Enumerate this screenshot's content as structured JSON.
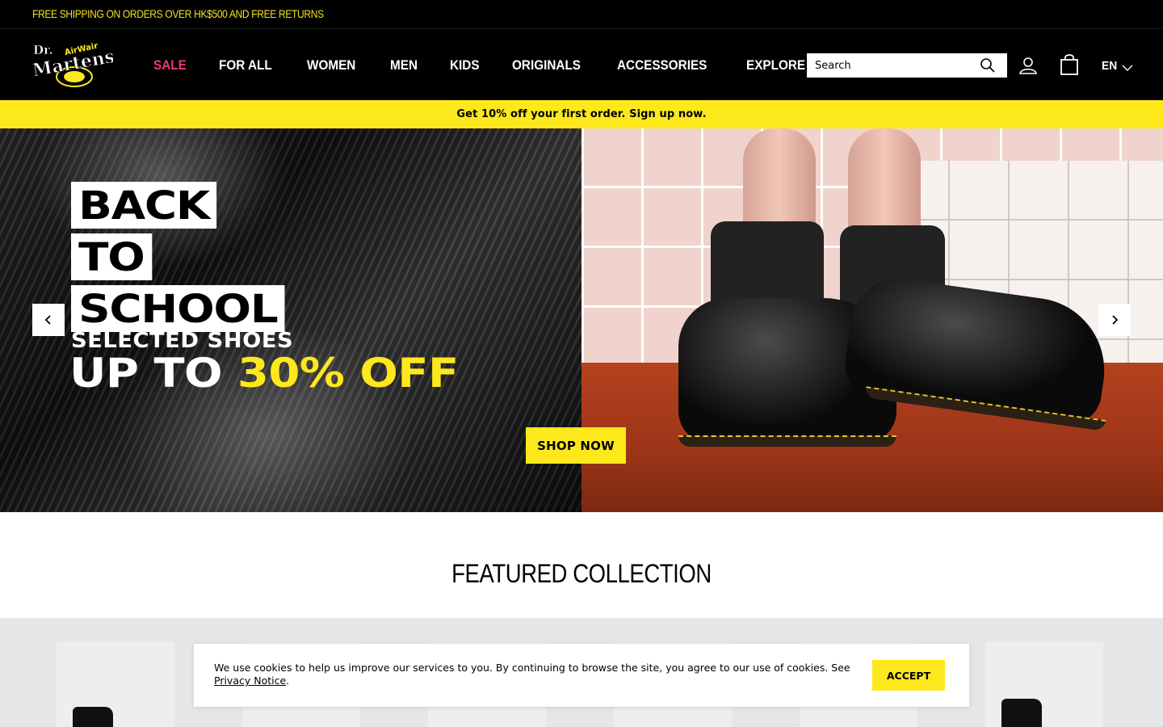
{
  "announcement": {
    "text": "FREE SHIPPING ON ORDERS OVER HK$500 AND FREE RETURNS"
  },
  "logo": {
    "text": "Dr. Martens AirWair"
  },
  "nav": {
    "items": [
      {
        "label": "SALE"
      },
      {
        "label": "FOR ALL"
      },
      {
        "label": "WOMEN"
      },
      {
        "label": "MEN"
      },
      {
        "label": "KIDS"
      },
      {
        "label": "ORIGINALS"
      },
      {
        "label": "ACCESSORIES"
      },
      {
        "label": "EXPLORE"
      }
    ]
  },
  "search": {
    "placeholder": "Search"
  },
  "language": {
    "label": "EN"
  },
  "promo": {
    "text": "Get 10% off your first order. Sign up now."
  },
  "hero": {
    "headline": [
      "BACK",
      "TO",
      "SCHOOL"
    ],
    "sub_line1": "SELECTED SHOES",
    "sub_line2_prefix": "UP TO",
    "sub_line2_accent": "30% OFF",
    "cta": "SHOP NOW"
  },
  "featured": {
    "title": "FEATURED COLLECTION"
  },
  "cookie": {
    "text": "We use cookies to help us improve our services to you. By continuing to browse the site, you agree to our use of cookies. See ",
    "link": "Privacy Notice",
    "suffix": ".",
    "accept": "ACCEPT"
  },
  "colors": {
    "brand_yellow": "#fde81b",
    "sale_pink": "#f0367e",
    "header_black": "#000000"
  },
  "icons": [
    "search-icon",
    "account-icon",
    "bag-icon",
    "chevron-down-icon",
    "chevron-left-icon",
    "chevron-right-icon"
  ]
}
